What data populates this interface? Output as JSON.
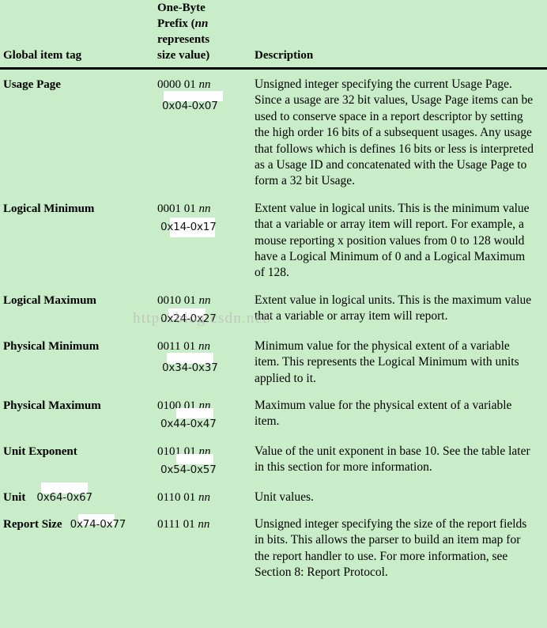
{
  "table": {
    "headers": {
      "tag": "Global item tag",
      "prefix_line1": "One-Byte",
      "prefix_line2_a": "Prefix (",
      "prefix_line2_nn": "nn",
      "prefix_line3": "represents",
      "prefix_line4": "size value)",
      "description": "Description"
    },
    "rows": [
      {
        "tag": "Usage Page",
        "prefix_bits": "0000 01",
        "prefix_nn": "nn",
        "annotation": "0x04-0x07",
        "description": "Unsigned integer specifying the current Usage Page. Since a usage are 32 bit values, Usage Page items can be used to conserve space in a report descriptor by setting the high order 16 bits of a subsequent usages. Any usage that follows which is defines 16 bits or less is interpreted as a Usage ID and concatenated with the Usage Page to form a 32 bit Usage."
      },
      {
        "tag": "Logical Minimum",
        "prefix_bits": "0001 01",
        "prefix_nn": "nn",
        "annotation": "0x14-0x17",
        "description": "Extent value in logical units. This is the minimum value that a variable or array item will report. For example, a mouse reporting x position values from 0 to 128 would have a Logical Minimum of 0 and a Logical Maximum of 128."
      },
      {
        "tag": "Logical Maximum",
        "prefix_bits": "0010 01",
        "prefix_nn": "nn",
        "annotation": "0x24-0x27",
        "description": "Extent value in logical units. This is the maximum value that a variable or array item will report."
      },
      {
        "tag": "Physical Minimum",
        "prefix_bits": "0011 01",
        "prefix_nn": "nn",
        "annotation": "0x34-0x37",
        "description": "Minimum value for the physical extent of a variable item. This represents the Logical Minimum with units applied to it."
      },
      {
        "tag": "Physical Maximum",
        "prefix_bits": "0100 01",
        "prefix_nn": "nn",
        "annotation": "0x44-0x47",
        "description": "Maximum value for the physical extent of a variable item."
      },
      {
        "tag": "Unit Exponent",
        "prefix_bits": "0101 01",
        "prefix_nn": "nn",
        "annotation": "0x54-0x57",
        "description": "Value of the unit exponent in base 10. See the table later in this section for more information."
      },
      {
        "tag": "Unit",
        "prefix_bits": "0110 01",
        "prefix_nn": "nn",
        "annotation": "0x64-0x67",
        "description": "Unit values."
      },
      {
        "tag": "Report Size",
        "prefix_bits": "0111 01",
        "prefix_nn": "nn",
        "annotation": "0x74-0x77",
        "description": "Unsigned integer specifying the size of the report fields in bits. This allows the parser to build an item map for the report handler to use. For more information, see Section 8: Report Protocol."
      }
    ]
  },
  "watermark": {
    "text": "http://blog.csdn.net/"
  },
  "colors": {
    "background": "#c9edc9",
    "text": "#000000",
    "rule": "#000000",
    "annotation_patch": "#ffffff",
    "watermark": "#b9a9b4"
  }
}
